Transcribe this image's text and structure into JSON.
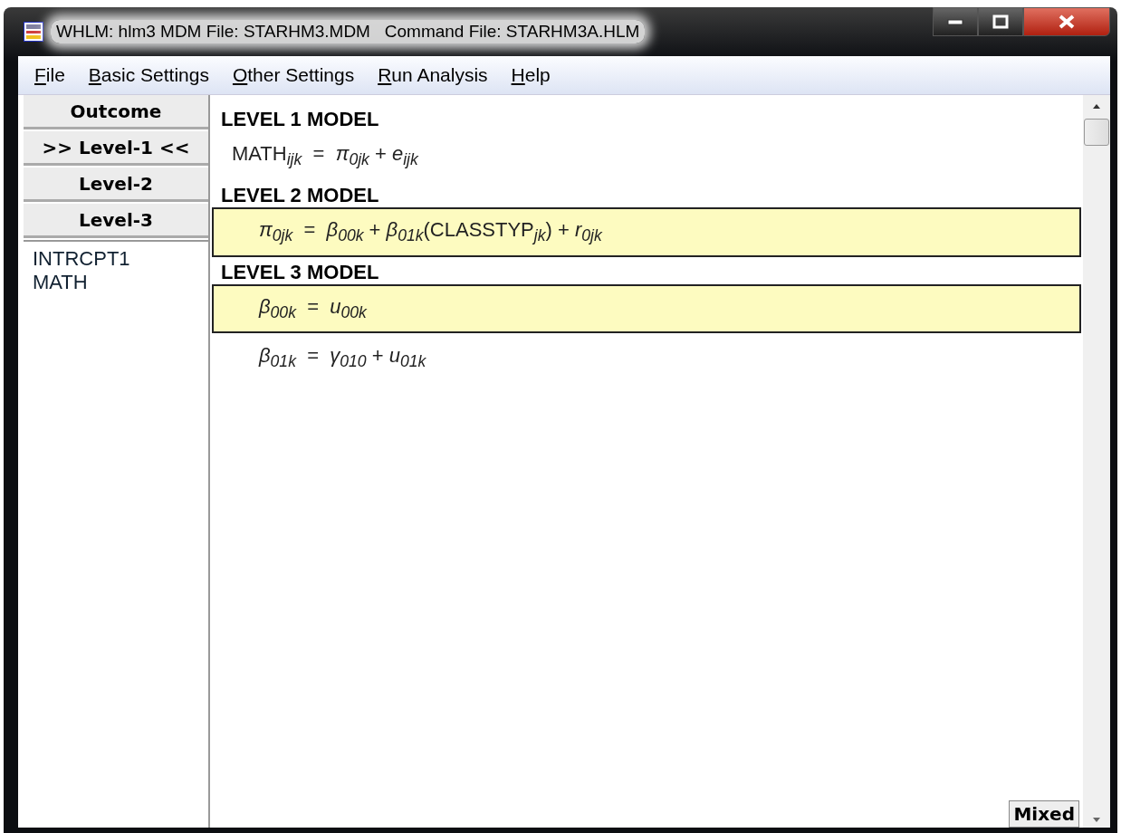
{
  "window": {
    "title": "WHLM: hlm3 MDM File: STARHM3.MDM   Command File: STARHM3A.HLM"
  },
  "menu": [
    "File",
    "Basic Settings",
    "Other Settings",
    "Run Analysis",
    "Help"
  ],
  "sidebar": {
    "buttons": [
      {
        "label": "Outcome"
      },
      {
        "label": ">> Level-1 <<"
      },
      {
        "label": "Level-2"
      },
      {
        "label": "Level-3"
      }
    ],
    "variables": [
      "INTRCPT1",
      "MATH"
    ]
  },
  "model": [
    {
      "heading": "LEVEL 1 MODEL",
      "equations": [
        {
          "text": "MATH$_{ijk}$  =  *π*$_{0jk}$ + *e*$_{ijk}$",
          "highlighted": false,
          "indented": false
        }
      ]
    },
    {
      "heading": "LEVEL 2 MODEL",
      "equations": [
        {
          "text": "*π*$_{0jk}$  =  *β*$_{00k}$ + *β*$_{01k}$(CLASSTYP$_{jk}$) + *r*$_{0jk}$",
          "highlighted": true,
          "indented": true
        }
      ]
    },
    {
      "heading": "LEVEL 3 MODEL",
      "equations": [
        {
          "text": "*β*$_{00k}$  =  *u*$_{00k}$",
          "highlighted": true,
          "indented": true
        },
        {
          "text": "*β*$_{01k}$  =  *γ*$_{010}$ + *u*$_{01k}$",
          "highlighted": false,
          "indented": true
        }
      ]
    }
  ],
  "mode_button": "Mixed"
}
